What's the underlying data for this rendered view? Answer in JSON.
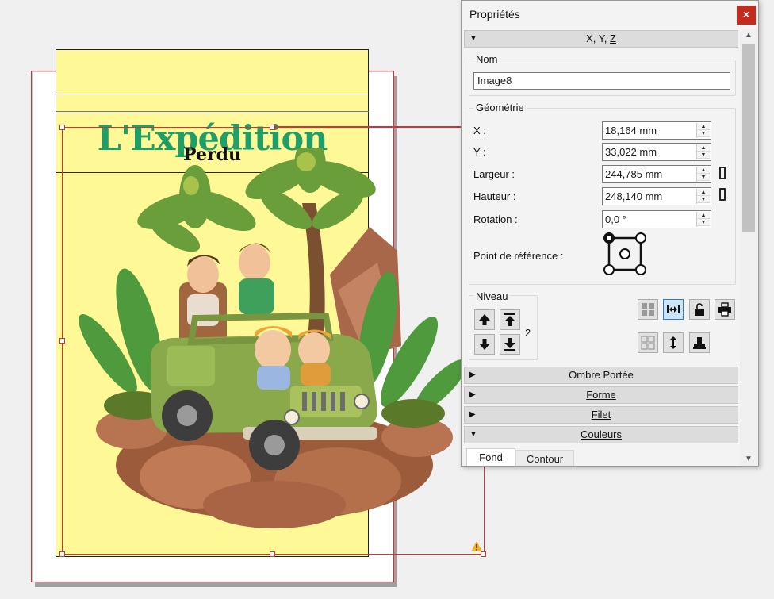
{
  "document": {
    "title_main": "L'Expédition",
    "title_sub": "Perdu",
    "image_description_icon": "jeep-jungle-illustration"
  },
  "panel": {
    "title": "Propriétés",
    "close_label": "×",
    "xyz_header": {
      "prefix": "X, Y, ",
      "underlined": "Z"
    },
    "name_group_label": "Nom",
    "name_value": "Image8",
    "geometry_group_label": "Géométrie",
    "fields": [
      {
        "label": "X :",
        "value": "18,164 mm"
      },
      {
        "label": "Y :",
        "value": "33,022 mm"
      },
      {
        "label": "Largeur :",
        "value": "244,785 mm"
      },
      {
        "label": "Hauteur :",
        "value": "248,140 mm"
      },
      {
        "label": "Rotation :",
        "value": "0,0 °"
      }
    ],
    "reference_point_label": "Point de référence :",
    "level_group_label": "Niveau",
    "level_value": "2",
    "sections": [
      {
        "label": "Ombre Portée",
        "expanded": false,
        "underline": false
      },
      {
        "label": "Forme",
        "expanded": false,
        "underline": true
      },
      {
        "label": "Filet",
        "expanded": false,
        "underline": true
      },
      {
        "label": "Couleurs",
        "expanded": true,
        "underline": true
      }
    ],
    "tabs": [
      "Fond",
      "Contour"
    ]
  },
  "colors": {
    "accent_red": "#d2323c",
    "title_green": "#1f9e68",
    "page_yellow": "#fff897",
    "close_red": "#c42b1c"
  }
}
